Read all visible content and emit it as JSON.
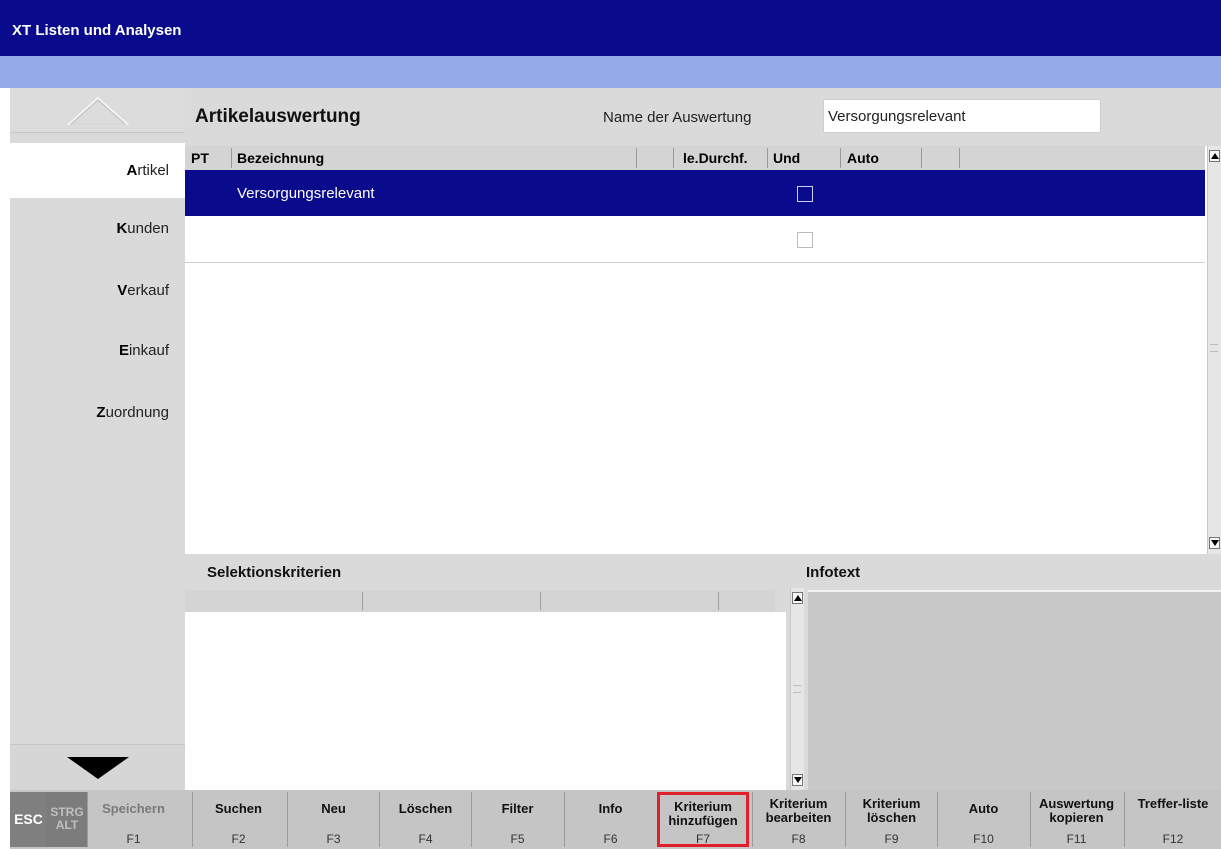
{
  "window": {
    "title": "XT Listen und Analysen"
  },
  "sidebar": {
    "items": [
      {
        "key": "A",
        "rest": "rtikel",
        "active": true
      },
      {
        "key": "K",
        "rest": "unden",
        "active": false
      },
      {
        "key": "V",
        "rest": "erkauf",
        "active": false
      },
      {
        "key": "E",
        "rest": "inkauf",
        "active": false
      },
      {
        "key": "Z",
        "rest": "uordnung",
        "active": false
      }
    ]
  },
  "header": {
    "heading": "Artikelauswertung",
    "name_label": "Name der Auswertung",
    "name_value": "Versorgungsrelevant"
  },
  "grid": {
    "columns": [
      "PT",
      "Bezeichnung",
      "le.Durchf.",
      "Und",
      "Auto"
    ],
    "rows": [
      {
        "bezeichnung": "Versorgungsrelevant",
        "und": false,
        "selected": true
      },
      {
        "bezeichnung": "",
        "und": false,
        "selected": false
      }
    ]
  },
  "criteria": {
    "title": "Selektionskriterien"
  },
  "info": {
    "title": "Infotext"
  },
  "fkeys": {
    "esc": "ESC",
    "strg": "STRG",
    "alt": "ALT",
    "keys": [
      {
        "label": "Speichern",
        "key": "F1",
        "enabled": false
      },
      {
        "label": "Suchen",
        "key": "F2",
        "enabled": true
      },
      {
        "label": "Neu",
        "key": "F3",
        "enabled": true
      },
      {
        "label": "Löschen",
        "key": "F4",
        "enabled": true
      },
      {
        "label": "Filter",
        "key": "F5",
        "enabled": true
      },
      {
        "label": "Info",
        "key": "F6",
        "enabled": true
      },
      {
        "label": "Kriterium hinzufügen",
        "key": "F7",
        "enabled": true,
        "highlighted": true
      },
      {
        "label": "Kriterium bearbeiten",
        "key": "F8",
        "enabled": true
      },
      {
        "label": "Kriterium löschen",
        "key": "F9",
        "enabled": true
      },
      {
        "label": "Auto",
        "key": "F10",
        "enabled": true
      },
      {
        "label": "Auswertung kopieren",
        "key": "F11",
        "enabled": true
      },
      {
        "label": "Treffer-liste",
        "key": "F12",
        "enabled": true
      }
    ]
  },
  "colors": {
    "titlebar": "#0a0a8c",
    "subbar": "#93aae6",
    "selection": "#0a0a8c",
    "highlight": "#e0202a"
  }
}
